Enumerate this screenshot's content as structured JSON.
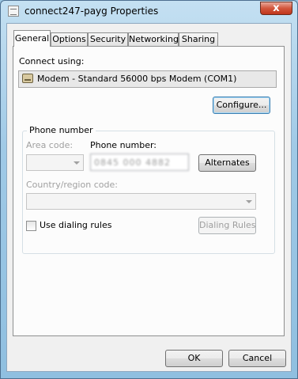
{
  "window": {
    "title": "connect247-payg Properties",
    "close_glyph": "x"
  },
  "tabs": [
    {
      "label": "General",
      "active": true
    },
    {
      "label": "Options",
      "active": false
    },
    {
      "label": "Security",
      "active": false
    },
    {
      "label": "Networking",
      "active": false
    },
    {
      "label": "Sharing",
      "active": false
    }
  ],
  "general": {
    "connect_using_label": "Connect using:",
    "device": "Modem - Standard 56000 bps Modem (COM1)",
    "configure_button": "Configure...",
    "phone_group": {
      "title": "Phone number",
      "area_code_label": "Area code:",
      "area_code_value": "",
      "phone_number_label": "Phone number:",
      "phone_number_value": "0845 000 4882",
      "alternates_button": "Alternates",
      "country_label": "Country/region code:",
      "country_value": "",
      "use_dialing_rules_label": "Use dialing rules",
      "use_dialing_rules_checked": false,
      "dialing_rules_button": "Dialing Rules"
    }
  },
  "footer": {
    "ok_button": "OK",
    "cancel_button": "Cancel"
  },
  "icons": {
    "title_icon": "network-connection-icon",
    "device_icon": "modem-icon",
    "close_icon": "close-icon"
  }
}
